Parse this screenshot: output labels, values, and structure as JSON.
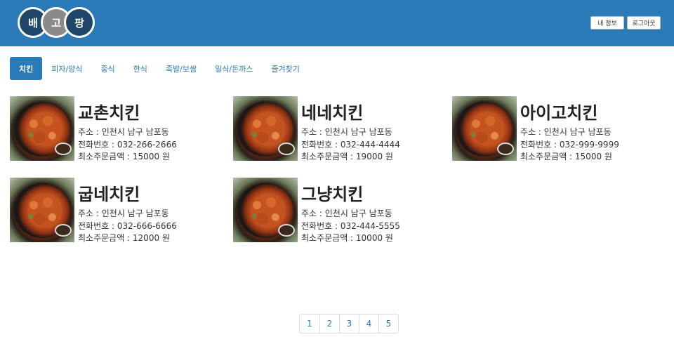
{
  "header": {
    "logo": [
      "배",
      "고",
      "팡"
    ],
    "my_info_label": "내 정보",
    "logout_label": "로그아웃",
    "background": "#2a7ab8"
  },
  "tabs": [
    {
      "label": "치킨",
      "active": true
    },
    {
      "label": "피자/양식",
      "active": false
    },
    {
      "label": "중식",
      "active": false
    },
    {
      "label": "한식",
      "active": false
    },
    {
      "label": "족발/보쌈",
      "active": false
    },
    {
      "label": "일식/돈까스",
      "active": false
    },
    {
      "label": "즐겨찾기",
      "active": false
    }
  ],
  "restaurants": [
    {
      "name": "교촌치킨",
      "address": "주소 : 인천시 남구 남포동",
      "phone": "전화번호 : 032-266-2666",
      "min_order": "최소주문금액 : 15000 원"
    },
    {
      "name": "네네치킨",
      "address": "주소 : 인천시 남구 남포동",
      "phone": "전화번호 : 032-444-4444",
      "min_order": "최소주문금액 : 19000 원"
    },
    {
      "name": "아이고치킨",
      "address": "주소 : 인천시 남구 남포동",
      "phone": "전화번호 : 032-999-9999",
      "min_order": "최소주문금액 : 15000 원"
    },
    {
      "name": "굽네치킨",
      "address": "주소 : 인천시 남구 남포동",
      "phone": "전화번호 : 032-666-6666",
      "min_order": "최소주문금액 : 12000 원"
    },
    {
      "name": "그냥치킨",
      "address": "주소 : 인천시 남구 남포동",
      "phone": "전화번호 : 032-444-5555",
      "min_order": "최소주문금액 : 10000 원"
    }
  ],
  "pagination": [
    "1",
    "2",
    "3",
    "4",
    "5"
  ],
  "colors": {
    "accent": "#2a7ab8",
    "logo_dark": "#1f4569",
    "logo_gray": "#8a8a8a"
  }
}
